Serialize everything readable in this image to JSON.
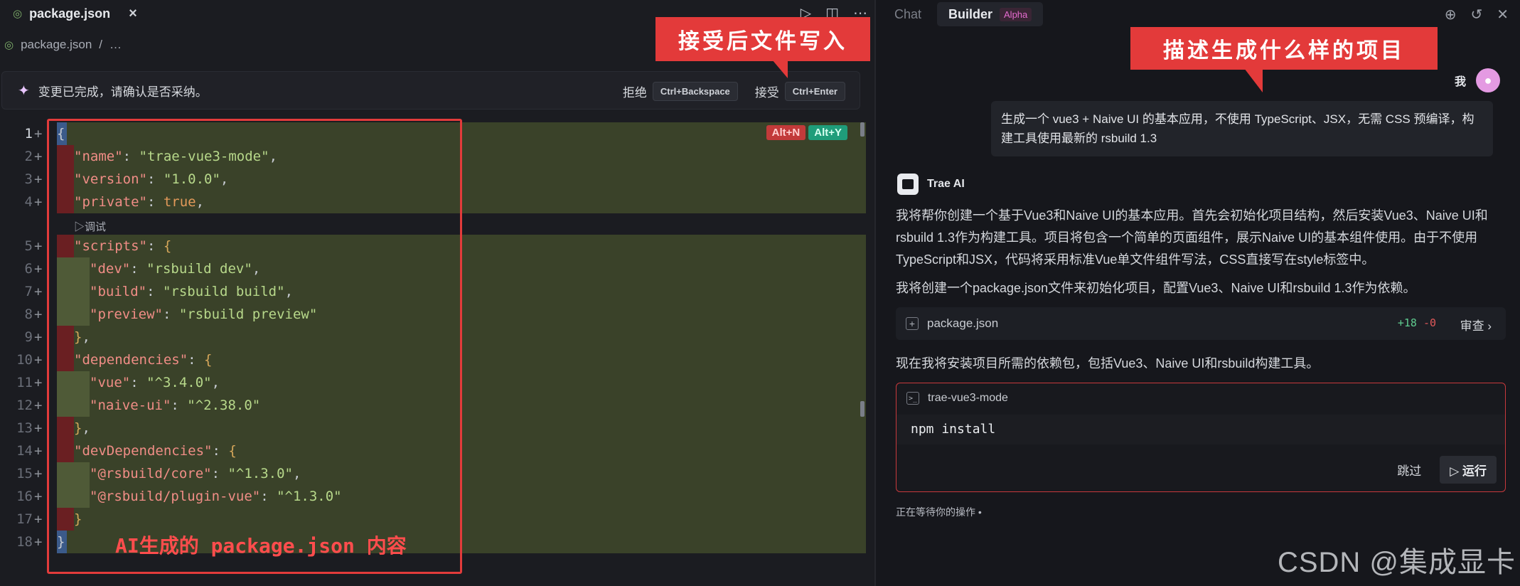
{
  "editor": {
    "tab_label": "package.json",
    "tab_close": "×",
    "breadcrumb_file": "package.json",
    "breadcrumb_more": "…",
    "banner_text": "变更已完成，请确认是否采纳。",
    "reject_label": "拒绝",
    "reject_shortcut": "Ctrl+Backspace",
    "accept_label": "接受",
    "accept_shortcut": "Ctrl+Enter",
    "tag_reject": "Alt+N",
    "tag_accept": "Alt+Y",
    "codelens": "▷调试",
    "line_numbers": [
      "1",
      "2",
      "3",
      "4",
      "5",
      "6",
      "7",
      "8",
      "9",
      "10",
      "11",
      "12",
      "13",
      "14",
      "15",
      "16",
      "17",
      "18"
    ],
    "code": {
      "name_key": "\"name\"",
      "name_val": "\"trae-vue3-mode\"",
      "version_key": "\"version\"",
      "version_val": "\"1.0.0\"",
      "private_key": "\"private\"",
      "private_val": "true",
      "scripts_key": "\"scripts\"",
      "dev_key": "\"dev\"",
      "dev_val": "\"rsbuild dev\"",
      "build_key": "\"build\"",
      "build_val": "\"rsbuild build\"",
      "preview_key": "\"preview\"",
      "preview_val": "\"rsbuild preview\"",
      "deps_key": "\"dependencies\"",
      "vue_key": "\"vue\"",
      "vue_val": "\"^3.4.0\"",
      "naive_key": "\"naive-ui\"",
      "naive_val": "\"^2.38.0\"",
      "devdeps_key": "\"devDependencies\"",
      "core_key": "\"@rsbuild/core\"",
      "core_val": "\"^1.3.0\"",
      "plugin_key": "\"@rsbuild/plugin-vue\"",
      "plugin_val": "\"^1.3.0\""
    }
  },
  "annotations": {
    "accept_write": "接受后文件写入",
    "describe_project": "描述生成什么样的项目",
    "ai_generated": "AI生成的 package.json 内容"
  },
  "panel": {
    "tab_chat": "Chat",
    "tab_builder": "Builder",
    "alpha_badge": "Alpha",
    "user_name": "我",
    "user_message": "生成一个 vue3 + Naive UI 的基本应用，不使用 TypeScript、JSX，无需 CSS 预编译，构建工具使用最新的 rsbuild 1.3",
    "ai_name": "Trae AI",
    "para1": "我将帮你创建一个基于Vue3和Naive UI的基本应用。首先会初始化项目结构，然后安装Vue3、Naive UI和rsbuild 1.3作为构建工具。项目将包含一个简单的页面组件，展示Naive UI的基本组件使用。由于不使用TypeScript和JSX，代码将采用标准Vue单文件组件写法，CSS直接写在style标签中。",
    "para2": "我将创建一个package.json文件来初始化项目，配置Vue3、Naive UI和rsbuild 1.3作为依赖。",
    "file_card_name": "package.json",
    "file_added": "+18",
    "file_removed": "-0",
    "review_label": "审查",
    "para3": "现在我将安装项目所需的依赖包，包括Vue3、Naive UI和rsbuild构建工具。",
    "terminal_name": "trae-vue3-mode",
    "terminal_command": "npm install",
    "skip_label": "跳过",
    "run_label": "▷ 运行",
    "waiting_text": "正在等待你的操作 •"
  },
  "watermark": "CSDN @集成显卡",
  "colors": {
    "annotation_red": "#e33a3a",
    "diff_added_bg": "#3a4229",
    "accent_pink": "#e56bcf"
  }
}
